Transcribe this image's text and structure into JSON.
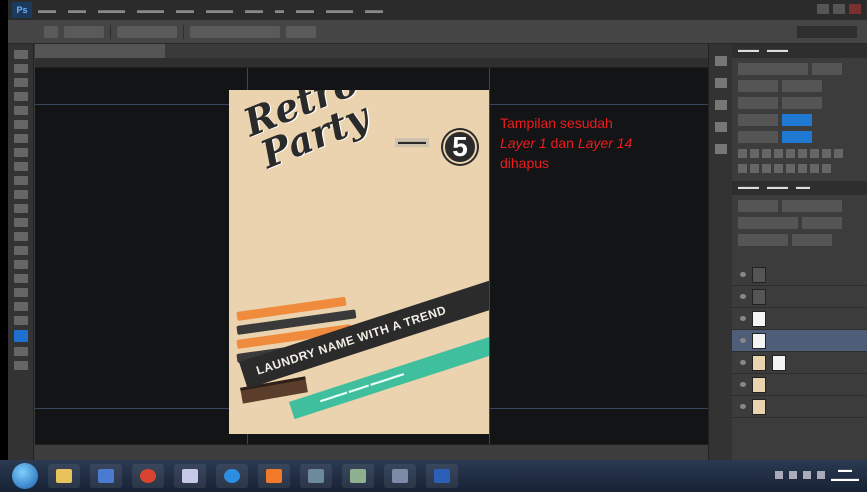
{
  "app": {
    "name": "Adobe Photoshop",
    "logo_text": "Ps"
  },
  "document": {
    "tab_label": ""
  },
  "annotation": {
    "line1": "Tampilan sesudah",
    "layer_a": "Layer 1",
    "connector": "dan",
    "layer_b": "Layer 14",
    "line3": "dihapus",
    "color": "#ee1c1c"
  },
  "poster": {
    "title_line1": "Retro",
    "title_line2": "Party",
    "badge_number": "5",
    "banner_text": "LAUNDRY NAME WITH A TREND"
  },
  "layers_panel": {
    "rows": [
      {
        "thumb": "folder",
        "selected": false
      },
      {
        "thumb": "folder",
        "selected": false
      },
      {
        "thumb": "white",
        "selected": false
      },
      {
        "thumb": "white",
        "selected": true
      },
      {
        "thumb": "poster",
        "selected": false
      },
      {
        "thumb": "poster",
        "selected": false
      },
      {
        "thumb": "poster",
        "selected": false
      }
    ]
  },
  "taskbar": {
    "apps": [
      "explorer",
      "media",
      "chrome",
      "gmail",
      "ie",
      "firefox",
      "photos",
      "notes",
      "taskview",
      "word"
    ]
  },
  "colors": {
    "canvas_bg": "#121416",
    "poster_bg": "#ead3ae",
    "accent_orange": "#f08a3c",
    "accent_teal": "#3fbf9d"
  }
}
